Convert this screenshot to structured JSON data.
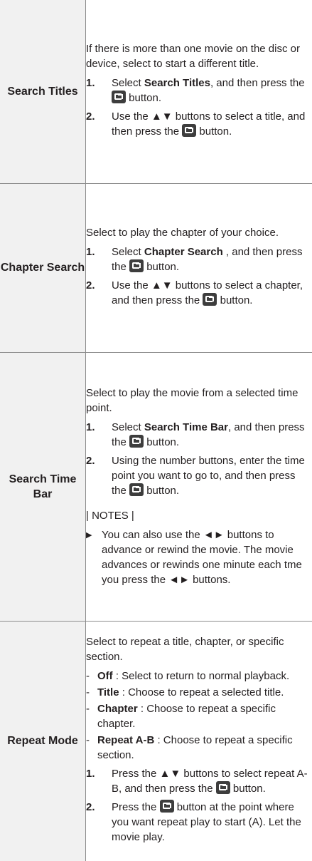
{
  "rows": [
    {
      "label": "Search Titles",
      "intro": "If there is more than one movie on the disc or device, select to start a different title.",
      "steps": [
        {
          "num": "1.",
          "pre": "Select ",
          "bold": "Search Titles",
          "mid": ", and then press the ",
          "post": " button."
        },
        {
          "num": "2.",
          "pre": "Use the ▲▼ buttons to select a title, and then press the ",
          "post": " button."
        }
      ]
    },
    {
      "label": "Chapter Search",
      "intro": "Select to play the chapter of your choice.",
      "steps": [
        {
          "num": "1.",
          "pre": "Select ",
          "bold": "Chapter Search",
          "mid": " , and then press the ",
          "post": " button."
        },
        {
          "num": "2.",
          "pre": "Use the ▲▼ buttons to select a chapter, and then press the ",
          "post": " button."
        }
      ]
    },
    {
      "label": "Search Time Bar",
      "intro": "Select to play the movie from a selected time point.",
      "steps": [
        {
          "num": "1.",
          "pre": "Select ",
          "bold": "Search Time Bar",
          "mid": ", and then press the ",
          "post": " button."
        },
        {
          "num": "2.",
          "pre": "Using the number buttons, enter the time point you want to go to, and then press the ",
          "post": " button."
        }
      ],
      "notes_label": "| NOTES |",
      "note": "You can also use the ◄► buttons to advance or rewind the movie. The movie advances or rewinds one minute each tme you press the ◄► buttons."
    },
    {
      "label": "Repeat Mode",
      "intro": "Select to repeat a title, chapter, or specific section.",
      "options": [
        {
          "bold": "Off",
          "text": " : Select to return to normal playback."
        },
        {
          "bold": "Title",
          "text": " : Choose to repeat a selected title."
        },
        {
          "bold": "Chapter",
          "text": " : Choose to repeat a specific chapter."
        },
        {
          "bold": "Repeat A-B",
          "text": " : Choose to repeat a specific section."
        }
      ],
      "steps": [
        {
          "num": "1.",
          "pre": "Press the ▲▼ buttons to select repeat A-B, and then press the ",
          "post": " button."
        },
        {
          "num": "2.",
          "pre": "Press the ",
          "post": " button at the point where you want repeat play to start (A). Let the movie play."
        }
      ]
    }
  ],
  "icons": {
    "enter": "enter-button-icon",
    "bullet": "play-triangle-icon"
  }
}
